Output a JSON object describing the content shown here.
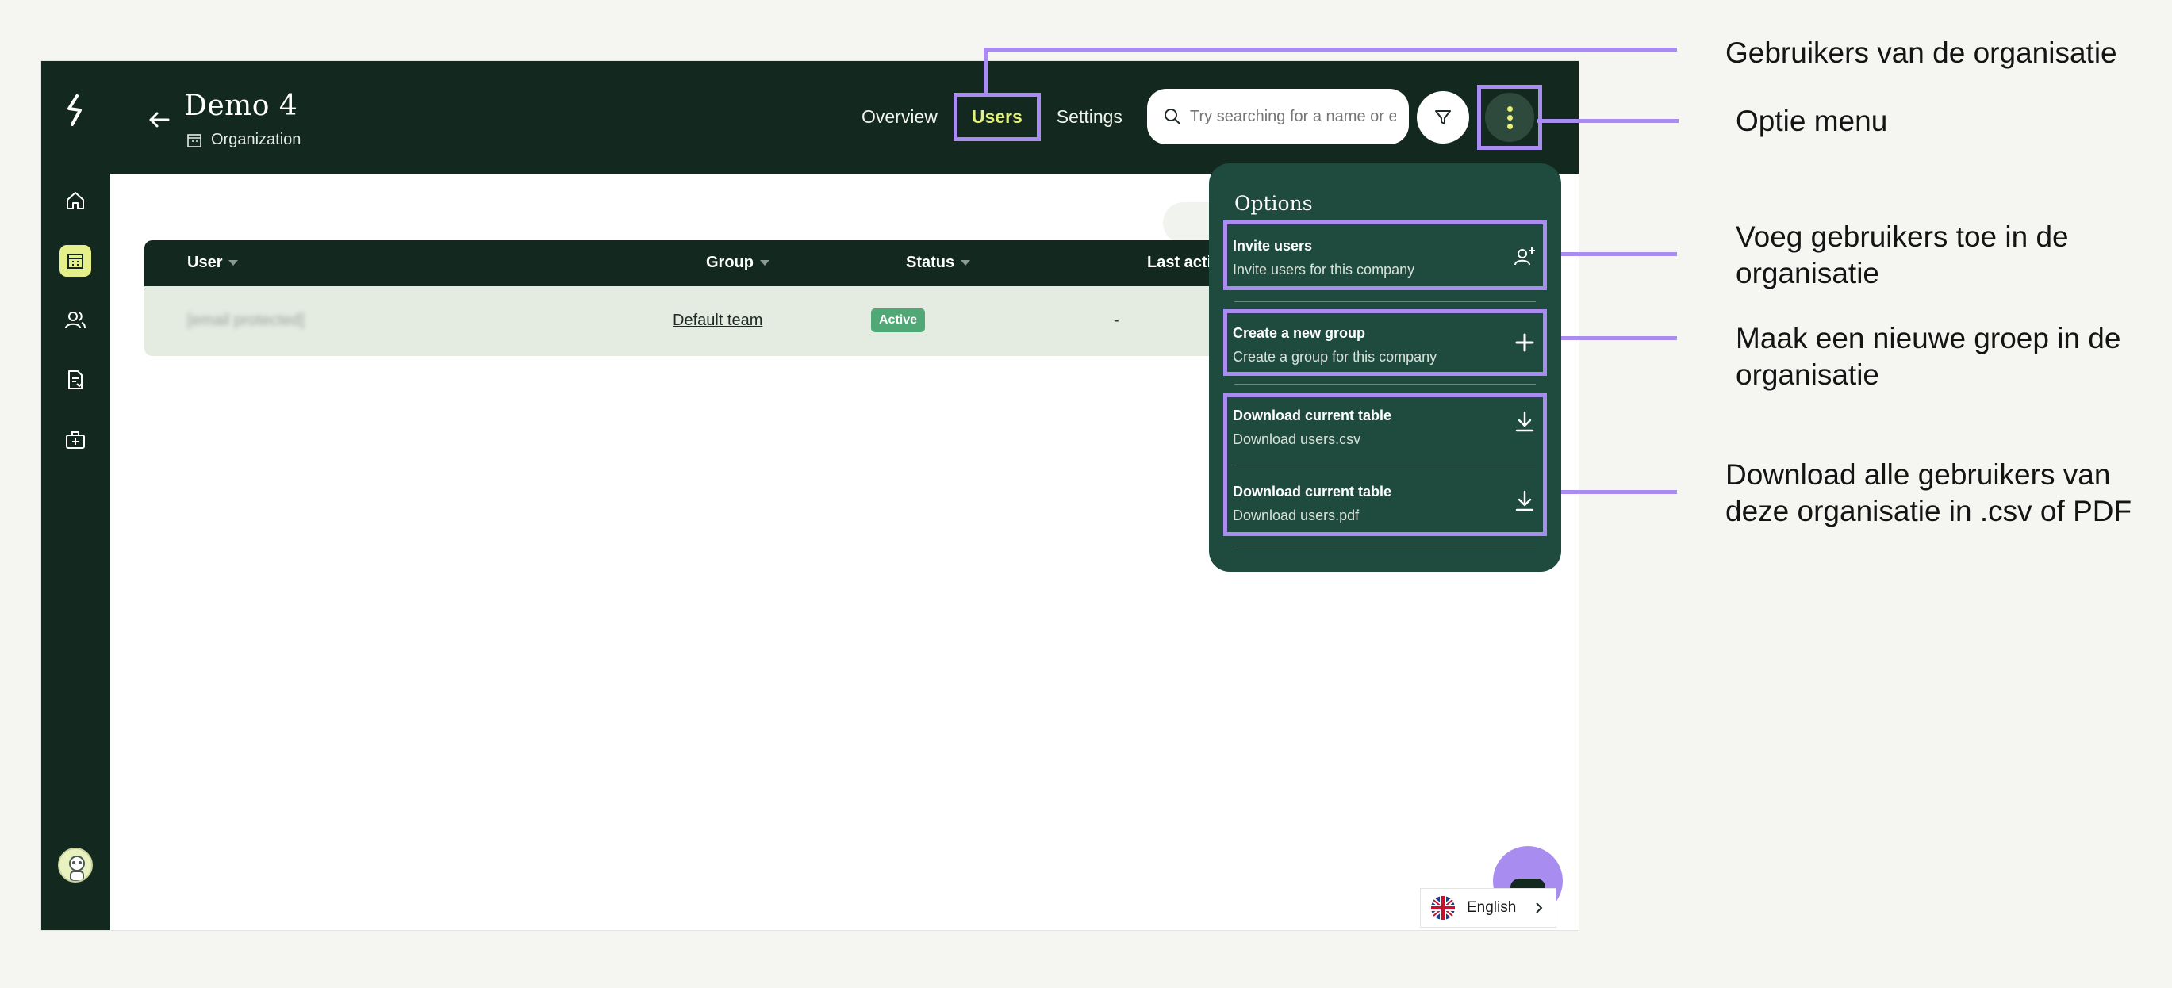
{
  "org": {
    "name": "Demo 4",
    "type": "Organization"
  },
  "tabs": [
    "Overview",
    "Users",
    "Settings"
  ],
  "active_tab": "Users",
  "search": {
    "placeholder": "Try searching for a name or e"
  },
  "table": {
    "columns": [
      "User",
      "Group",
      "Status",
      "Last activity"
    ],
    "rows": [
      {
        "user": "[email protected]",
        "group": "Default team",
        "status": "Active",
        "last_activity": "-"
      }
    ]
  },
  "menu": {
    "title": "Options",
    "items": [
      {
        "title": "Invite users",
        "subtitle": "Invite users for this company",
        "icon": "person-add-icon"
      },
      {
        "title": "Create a new group",
        "subtitle": "Create a group for this company",
        "icon": "plus-icon"
      },
      {
        "title": "Download current table",
        "subtitle": "Download users.csv",
        "icon": "download-icon"
      },
      {
        "title": "Download current table",
        "subtitle": "Download users.pdf",
        "icon": "download-icon"
      }
    ]
  },
  "language": "English",
  "annotations": {
    "users_tab": "Gebruikers van de organisatie",
    "options_menu": "Optie menu",
    "invite": "Voeg gebruikers toe in de organisatie",
    "group": "Maak een nieuwe groep in de organisatie",
    "download": "Download alle gebruikers van deze organisatie in .csv of PDF"
  },
  "colors": {
    "dark": "#13291f",
    "menu": "#1f4a3e",
    "accent": "#e3f07a",
    "highlight": "#a88cf0",
    "status_active": "#4fa875"
  }
}
